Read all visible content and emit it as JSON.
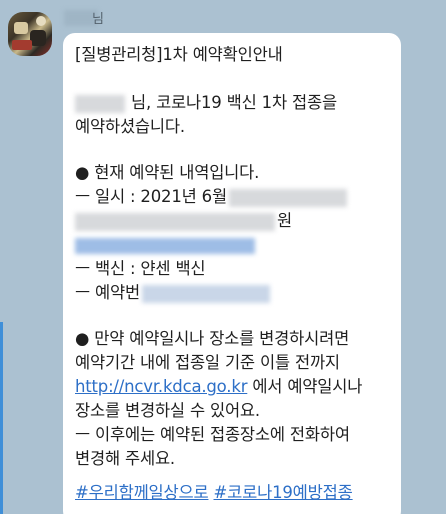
{
  "sender": {
    "name_suffix": "님"
  },
  "message": {
    "title": "[질병관리청]1차 예약확인안내",
    "greeting_line1_suffix": "님, 코로나19 백신 1차 접종을",
    "greeting_line2": "예약하셨습니다.",
    "details_header": "● 현재 예약된 내역입니다.",
    "date_label": "ㅡ 일시 : 2021년 6월",
    "place_suffix": "원",
    "vaccine_line": "ㅡ 백신 : 얀센 백신",
    "reservation_label": "ㅡ 예약번",
    "change_line1": "● 만약 예약일시나 장소를 변경하시려면",
    "change_line2": "예약기간 내에 접종일 기준 이틀 전까지",
    "change_link": "http://ncvr.kdca.go.kr",
    "change_line3_suffix": " 에서 예약일시나",
    "change_line4": "장소를 변경하실 수 있어요.",
    "after_line1": "ㅡ 이후에는 예약된 접종장소에 전화하여",
    "after_line2": "변경해 주세요.",
    "hashtag1": "#우리함께일상으로",
    "hashtag2": "#코로나19예방접종"
  },
  "colors": {
    "chat_background": "#abc1d1",
    "bubble": "#ffffff",
    "link": "#2d6fc7"
  }
}
